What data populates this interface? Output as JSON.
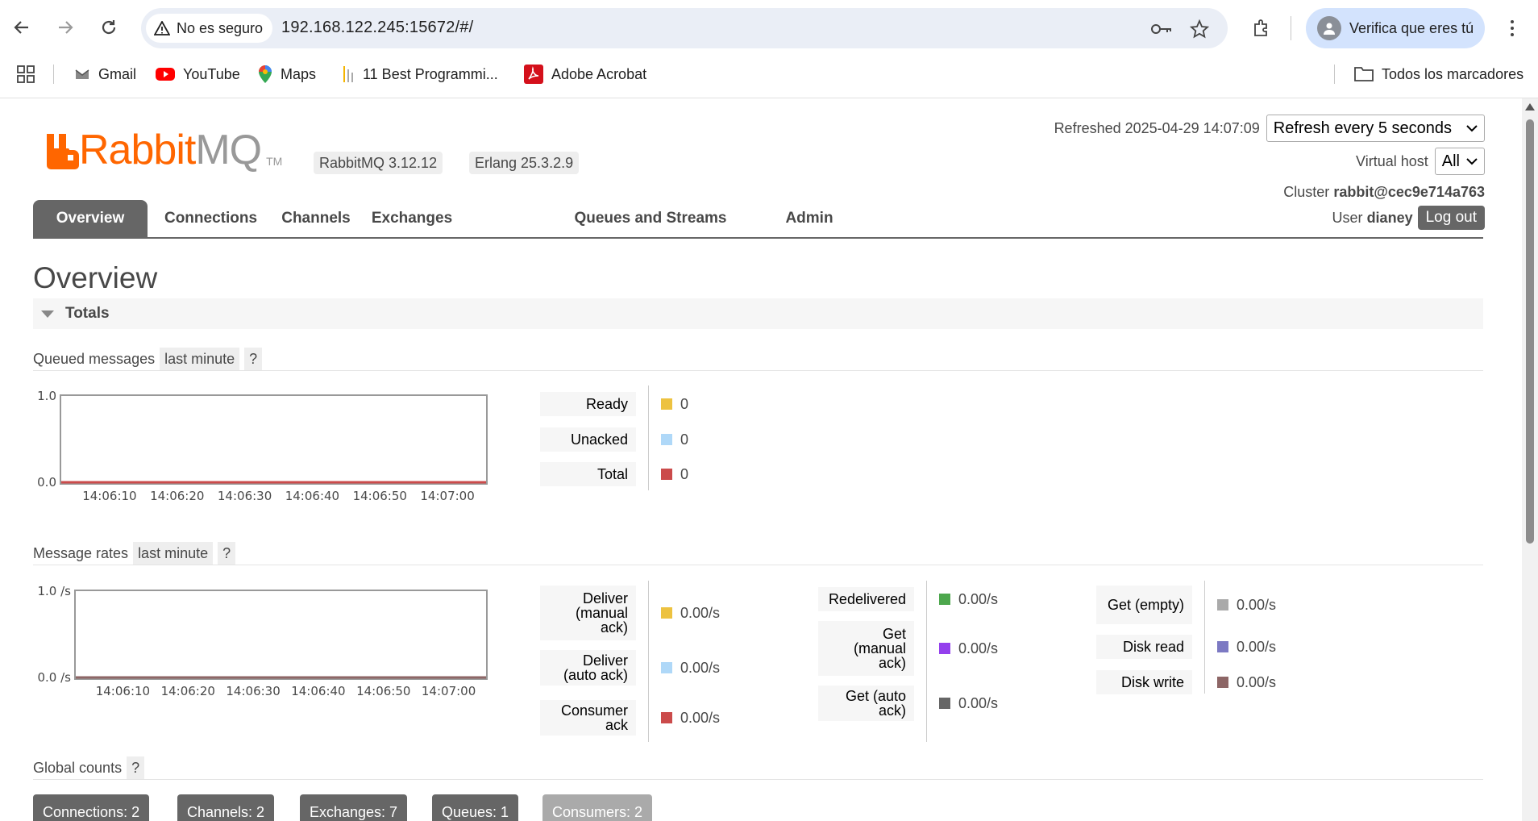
{
  "browser": {
    "security_label": "No es seguro",
    "url": "192.168.122.245:15672/#/",
    "profile_label": "Verifica que eres tú",
    "bookmarks": [
      {
        "label": "Gmail"
      },
      {
        "label": "YouTube"
      },
      {
        "label": "Maps"
      },
      {
        "label": "11 Best Programmi..."
      },
      {
        "label": "Adobe Acrobat"
      }
    ],
    "all_bookmarks_label": "Todos los marcadores"
  },
  "header": {
    "logo_rabbit": "Rabbit",
    "logo_mq": "MQ",
    "logo_tm": "TM",
    "rabbitmq_version": "RabbitMQ 3.12.12",
    "erlang_version": "Erlang 25.3.2.9",
    "refreshed_label": "Refreshed 2025-04-29 14:07:09",
    "refresh_select": "Refresh every 5 seconds",
    "virtual_host_label": "Virtual host",
    "virtual_host_value": "All",
    "cluster_label": "Cluster",
    "cluster_value": "rabbit@cec9e714a763",
    "user_label": "User",
    "user_value": "dianey",
    "logout_label": "Log out"
  },
  "tabs": [
    {
      "label": "Overview",
      "active": true
    },
    {
      "label": "Connections"
    },
    {
      "label": "Channels"
    },
    {
      "label": "Exchanges"
    },
    {
      "label": "Queues and Streams"
    },
    {
      "label": "Admin"
    }
  ],
  "page_title": "Overview",
  "totals_section": "Totals",
  "queued": {
    "title": "Queued messages",
    "range": "last minute",
    "help": "?",
    "y_top": "1.0",
    "y_bottom": "0.0",
    "x_ticks": [
      "14:06:10",
      "14:06:20",
      "14:06:30",
      "14:06:40",
      "14:06:50",
      "14:07:00"
    ],
    "legend": [
      {
        "label": "Ready",
        "value": "0",
        "color": "#edc240"
      },
      {
        "label": "Unacked",
        "value": "0",
        "color": "#afd8f8"
      },
      {
        "label": "Total",
        "value": "0",
        "color": "#cb4b4b"
      }
    ]
  },
  "rates": {
    "title": "Message rates",
    "range": "last minute",
    "help": "?",
    "y_top": "1.0 /s",
    "y_bottom": "0.0 /s",
    "x_ticks": [
      "14:06:10",
      "14:06:20",
      "14:06:30",
      "14:06:40",
      "14:06:50",
      "14:07:00"
    ],
    "col1": [
      {
        "label": "Deliver (manual ack)",
        "value": "0.00/s",
        "color": "#edc240"
      },
      {
        "label": "Deliver (auto ack)",
        "value": "0.00/s",
        "color": "#afd8f8"
      },
      {
        "label": "Consumer ack",
        "value": "0.00/s",
        "color": "#cb4b4b"
      }
    ],
    "col2": [
      {
        "label": "Redelivered",
        "value": "0.00/s",
        "color": "#4da74d"
      },
      {
        "label": "Get (manual ack)",
        "value": "0.00/s",
        "color": "#9440ed"
      },
      {
        "label": "Get (auto ack)",
        "value": "0.00/s",
        "color": "#666666"
      }
    ],
    "col3": [
      {
        "label": "Get (empty)",
        "value": "0.00/s",
        "color": "#aaaaaa"
      },
      {
        "label": "Disk read",
        "value": "0.00/s",
        "color": "#7c79c3"
      },
      {
        "label": "Disk write",
        "value": "0.00/s",
        "color": "#8d6666"
      }
    ]
  },
  "global_counts": {
    "title": "Global counts",
    "help": "?",
    "items": [
      {
        "label": "Connections: 2"
      },
      {
        "label": "Channels: 2"
      },
      {
        "label": "Exchanges: 7"
      },
      {
        "label": "Queues: 1"
      },
      {
        "label": "Consumers: 2"
      }
    ]
  },
  "chart_data": [
    {
      "type": "line",
      "title": "Queued messages",
      "x": [
        "14:06:10",
        "14:06:20",
        "14:06:30",
        "14:06:40",
        "14:06:50",
        "14:07:00"
      ],
      "series": [
        {
          "name": "Ready",
          "values": [
            0,
            0,
            0,
            0,
            0,
            0
          ]
        },
        {
          "name": "Unacked",
          "values": [
            0,
            0,
            0,
            0,
            0,
            0
          ]
        },
        {
          "name": "Total",
          "values": [
            0,
            0,
            0,
            0,
            0,
            0
          ]
        }
      ],
      "ylim": [
        0,
        1.0
      ]
    },
    {
      "type": "line",
      "title": "Message rates",
      "x": [
        "14:06:10",
        "14:06:20",
        "14:06:30",
        "14:06:40",
        "14:06:50",
        "14:07:00"
      ],
      "series": [
        {
          "name": "Deliver (manual ack)",
          "values": [
            0,
            0,
            0,
            0,
            0,
            0
          ]
        },
        {
          "name": "Deliver (auto ack)",
          "values": [
            0,
            0,
            0,
            0,
            0,
            0
          ]
        },
        {
          "name": "Consumer ack",
          "values": [
            0,
            0,
            0,
            0,
            0,
            0
          ]
        },
        {
          "name": "Redelivered",
          "values": [
            0,
            0,
            0,
            0,
            0,
            0
          ]
        },
        {
          "name": "Get (manual ack)",
          "values": [
            0,
            0,
            0,
            0,
            0,
            0
          ]
        },
        {
          "name": "Get (auto ack)",
          "values": [
            0,
            0,
            0,
            0,
            0,
            0
          ]
        },
        {
          "name": "Get (empty)",
          "values": [
            0,
            0,
            0,
            0,
            0,
            0
          ]
        },
        {
          "name": "Disk read",
          "values": [
            0,
            0,
            0,
            0,
            0,
            0
          ]
        },
        {
          "name": "Disk write",
          "values": [
            0,
            0,
            0,
            0,
            0,
            0
          ]
        }
      ],
      "ylim": [
        0,
        1.0
      ]
    }
  ]
}
